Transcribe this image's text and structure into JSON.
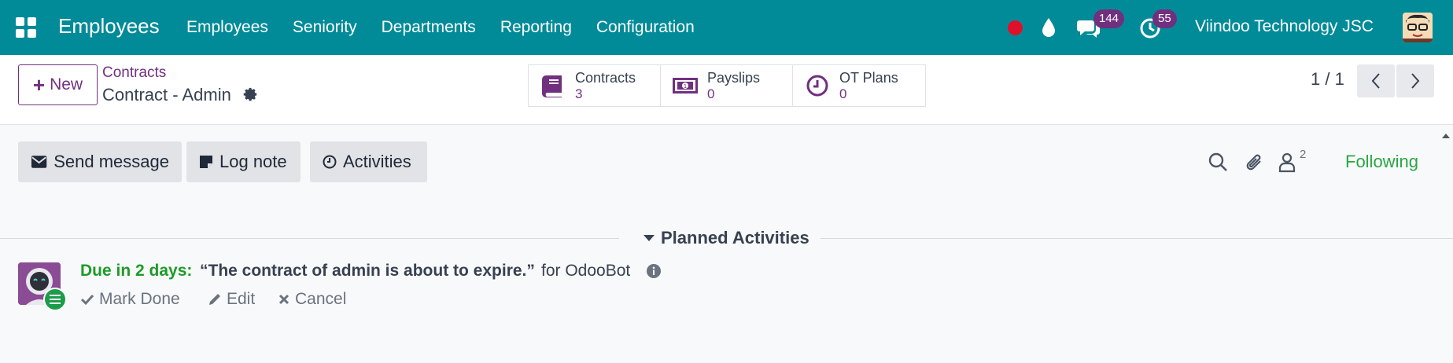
{
  "navbar": {
    "app_name": "Employees",
    "menu": [
      "Employees",
      "Seniority",
      "Departments",
      "Reporting",
      "Configuration"
    ],
    "messages_count": "144",
    "activities_count": "55",
    "company": "Viindoo Technology JSC",
    "bg_color": "#018b98"
  },
  "control_panel": {
    "new_label": "New",
    "breadcrumb": "Contracts",
    "record_title": "Contract - Admin",
    "smart_buttons": [
      {
        "icon": "book-icon",
        "label": "Contracts",
        "value": "3"
      },
      {
        "icon": "money-icon",
        "label": "Payslips",
        "value": "0"
      },
      {
        "icon": "clock-icon",
        "label": "OT Plans",
        "value": "0"
      }
    ],
    "pager": "1 / 1",
    "accent_color": "#71307f"
  },
  "chatter": {
    "send_message": "Send message",
    "log_note": "Log note",
    "activities": "Activities",
    "followers_count": "2",
    "following": "Following",
    "planned_title": "Planned Activities",
    "activity": {
      "due": "Due in 2 days:",
      "summary": "“The contract of admin is about to expire.”",
      "for": "for OdooBot",
      "mark_done": "Mark Done",
      "edit": "Edit",
      "cancel": "Cancel"
    }
  }
}
